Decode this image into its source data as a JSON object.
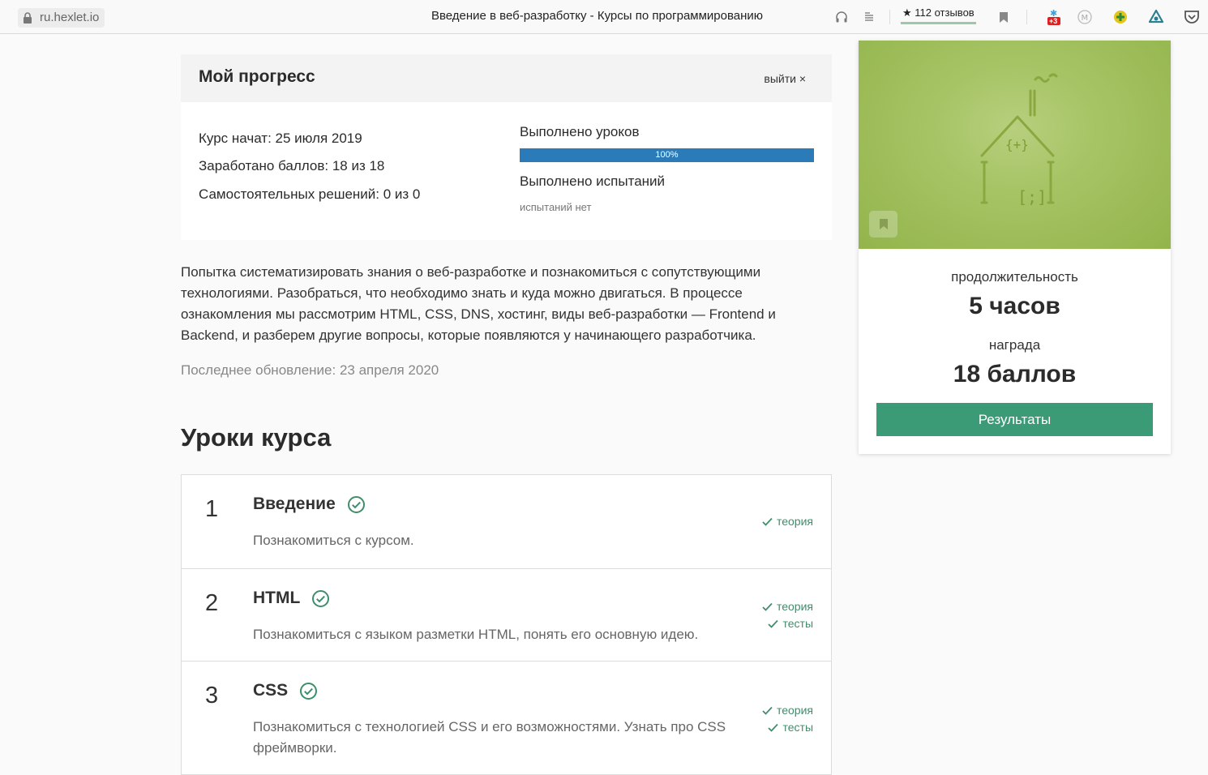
{
  "browser": {
    "url": "ru.hexlet.io",
    "title": "Введение в веб-разработку - Курсы по программированию",
    "reviews": "★ 112 отзывов",
    "badge": "+3"
  },
  "progress": {
    "title": "Мой прогресс",
    "logout": "выйти ×",
    "started": "Курс начат: 25 июля 2019",
    "points": "Заработано баллов: 18 из 18",
    "solutions": "Самостоятельных решений: 0 из 0",
    "lessons_done_label": "Выполнено уроков",
    "lessons_done_value": 100,
    "lessons_done_text": "100%",
    "tests_done_label": "Выполнено испытаний",
    "no_tests": "испытаний нет"
  },
  "course": {
    "description": "Попытка систематизировать знания о веб-разработке и познакомиться с сопутствующими технологиями. Разобраться, что необходимо знать и куда можно двигаться. В процессе ознакомления мы рассмотрим HTML, CSS, DNS, хостинг, виды веб-разработки — Frontend и Backend, и разберем другие вопросы, которые появляются у начинающего разработчика.",
    "updated": "Последнее обновление: 23 апреля 2020",
    "lessons_heading": "Уроки курса"
  },
  "lessons": [
    {
      "num": "1",
      "title": "Введение",
      "desc": "Познакомиться с курсом.",
      "tags": [
        "теория"
      ]
    },
    {
      "num": "2",
      "title": "HTML",
      "desc": "Познакомиться с языком разметки HTML, понять его основную идею.",
      "tags": [
        "теория",
        "тесты"
      ]
    },
    {
      "num": "3",
      "title": "CSS",
      "desc": "Познакомиться с технологией CSS и его возможностями. Узнать про CSS фреймворки.",
      "tags": [
        "теория",
        "тесты"
      ]
    }
  ],
  "side": {
    "duration_label": "продолжительность",
    "duration_value": "5 часов",
    "reward_label": "награда",
    "reward_value": "18 баллов",
    "results_button": "Результаты",
    "cover_code_top": "{+}",
    "cover_code_bottom": "[;]"
  },
  "colors": {
    "accent_green": "#3a9b76",
    "progress_blue": "#2b7bb9",
    "cover_green": "#a6c464"
  }
}
